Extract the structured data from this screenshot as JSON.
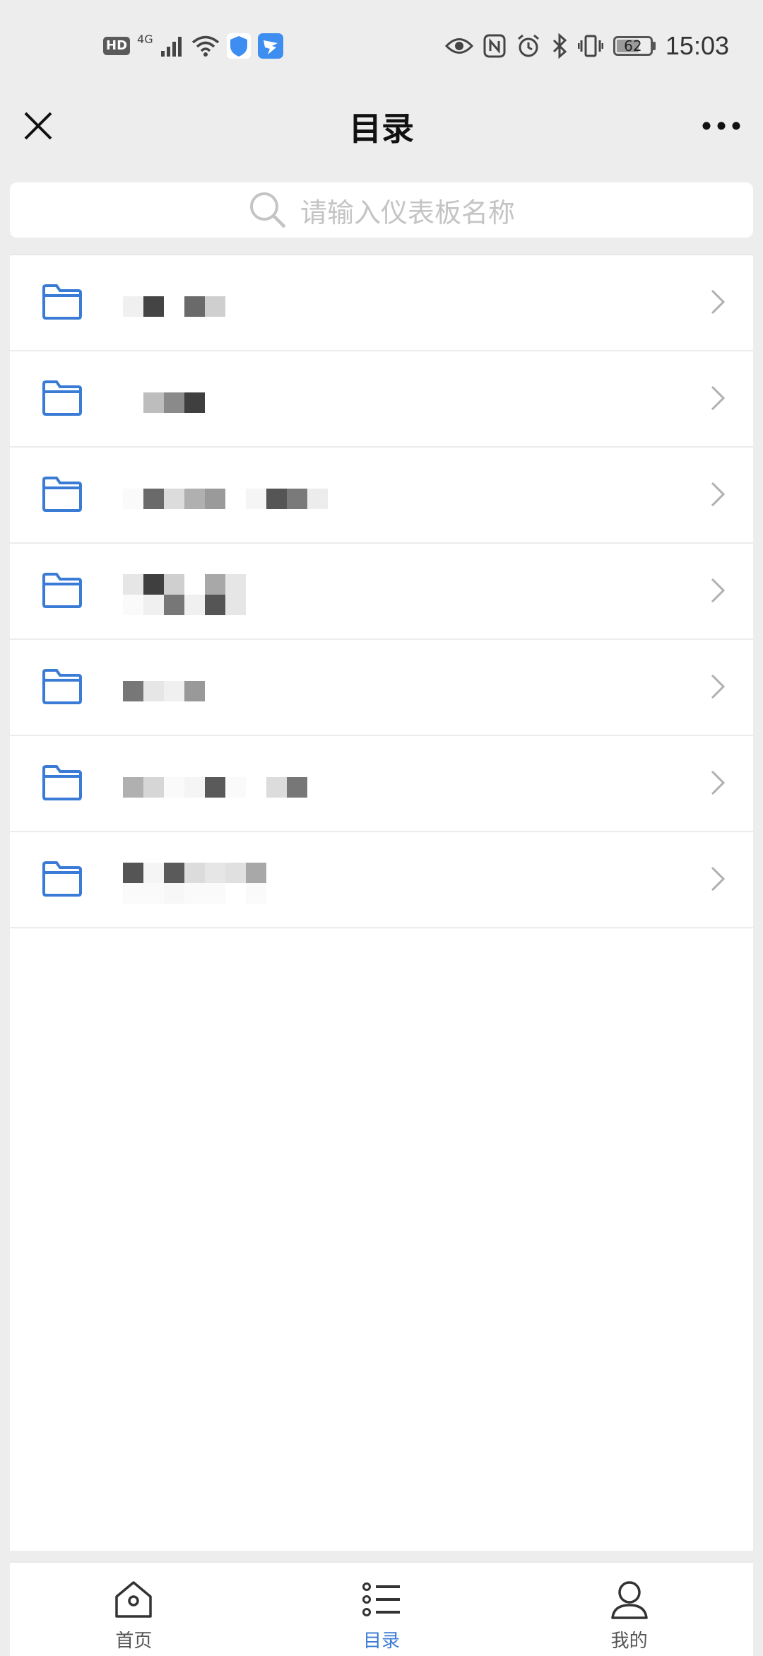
{
  "status_bar": {
    "left_icons": [
      "hd-icon",
      "4g-signal-icon",
      "wifi-icon",
      "shield-app-icon",
      "dingtalk-app-icon"
    ],
    "hd_label": "HD",
    "network_label": "4G",
    "right_icons": [
      "eye-icon",
      "nfc-icon",
      "alarm-icon",
      "bluetooth-icon",
      "vibrate-icon",
      "battery-icon"
    ],
    "battery_percent": "62",
    "time": "15:03"
  },
  "nav": {
    "title": "目录",
    "close_icon": "close-icon",
    "more_icon": "more-icon"
  },
  "search": {
    "placeholder": "请输入仪表板名称",
    "icon": "search-icon"
  },
  "folders": [
    {
      "icon": "folder-icon",
      "label": "",
      "obscured": true
    },
    {
      "icon": "folder-icon",
      "label": "",
      "obscured": true
    },
    {
      "icon": "folder-icon",
      "label": "",
      "obscured": true
    },
    {
      "icon": "folder-icon",
      "label": "",
      "obscured": true
    },
    {
      "icon": "folder-icon",
      "label": "",
      "obscured": true
    },
    {
      "icon": "folder-icon",
      "label": "",
      "obscured": true
    },
    {
      "icon": "folder-icon",
      "label": "",
      "obscured": true
    }
  ],
  "tabs": [
    {
      "icon": "home-icon",
      "label": "首页",
      "active": false
    },
    {
      "icon": "list-icon",
      "label": "目录",
      "active": true
    },
    {
      "icon": "user-icon",
      "label": "我的",
      "active": false
    }
  ],
  "colors": {
    "accent": "#3a7bd5",
    "folder": "#3a7bd5",
    "background": "#ededed"
  }
}
